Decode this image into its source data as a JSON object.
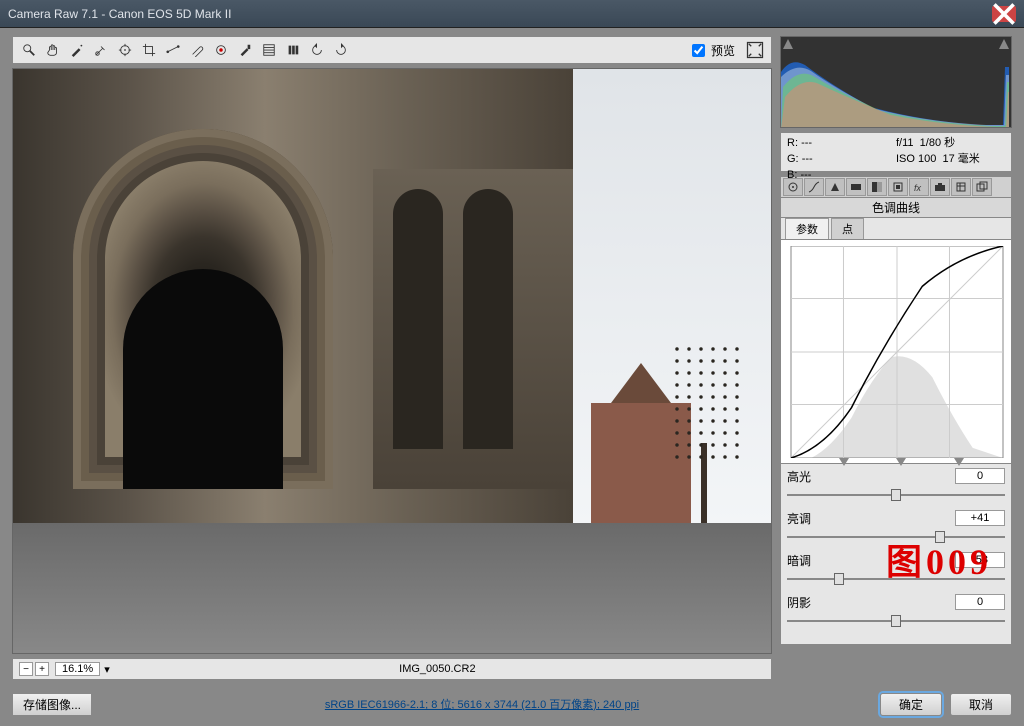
{
  "window_title": "Camera Raw 7.1  -  Canon EOS 5D Mark II",
  "toolbar": {
    "preview_label": "预览",
    "preview_checked": true
  },
  "zoom": {
    "value": "16.1%",
    "filename": "IMG_0050.CR2"
  },
  "meta": {
    "r_label": "R:",
    "g_label": "G:",
    "b_label": "B:",
    "r_val": "---",
    "g_val": "---",
    "b_val": "---",
    "aperture": "f/11",
    "shutter": "1/80 秒",
    "iso": "ISO 100",
    "focal": "17 毫米"
  },
  "panel": {
    "title": "色调曲线",
    "tab_param": "参数",
    "tab_point": "点"
  },
  "sliders": {
    "highlights": {
      "label": "高光",
      "value": "0",
      "pos": 50
    },
    "lights": {
      "label": "亮调",
      "value": "+41",
      "pos": 70
    },
    "darks": {
      "label": "暗调",
      "value": "-53",
      "pos": 24
    },
    "shadows": {
      "label": "阴影",
      "value": "0",
      "pos": 50
    }
  },
  "watermark": "图009",
  "bottom": {
    "save": "存储图像...",
    "link": "sRGB IEC61966-2.1; 8 位; 5616 x 3744 (21.0 百万像素); 240 ppi",
    "ok": "确定",
    "cancel": "取消"
  },
  "chart_data": {
    "type": "line",
    "title": "色调曲线",
    "xlabel": "",
    "ylabel": "",
    "xlim": [
      0,
      255
    ],
    "ylim": [
      0,
      255
    ],
    "series": [
      {
        "name": "curve",
        "x": [
          0,
          40,
          80,
          128,
          180,
          220,
          255
        ],
        "y": [
          0,
          18,
          60,
          150,
          220,
          248,
          255
        ]
      },
      {
        "name": "baseline",
        "x": [
          0,
          255
        ],
        "y": [
          0,
          255
        ]
      }
    ],
    "region_handles": [
      64,
      128,
      192
    ]
  }
}
